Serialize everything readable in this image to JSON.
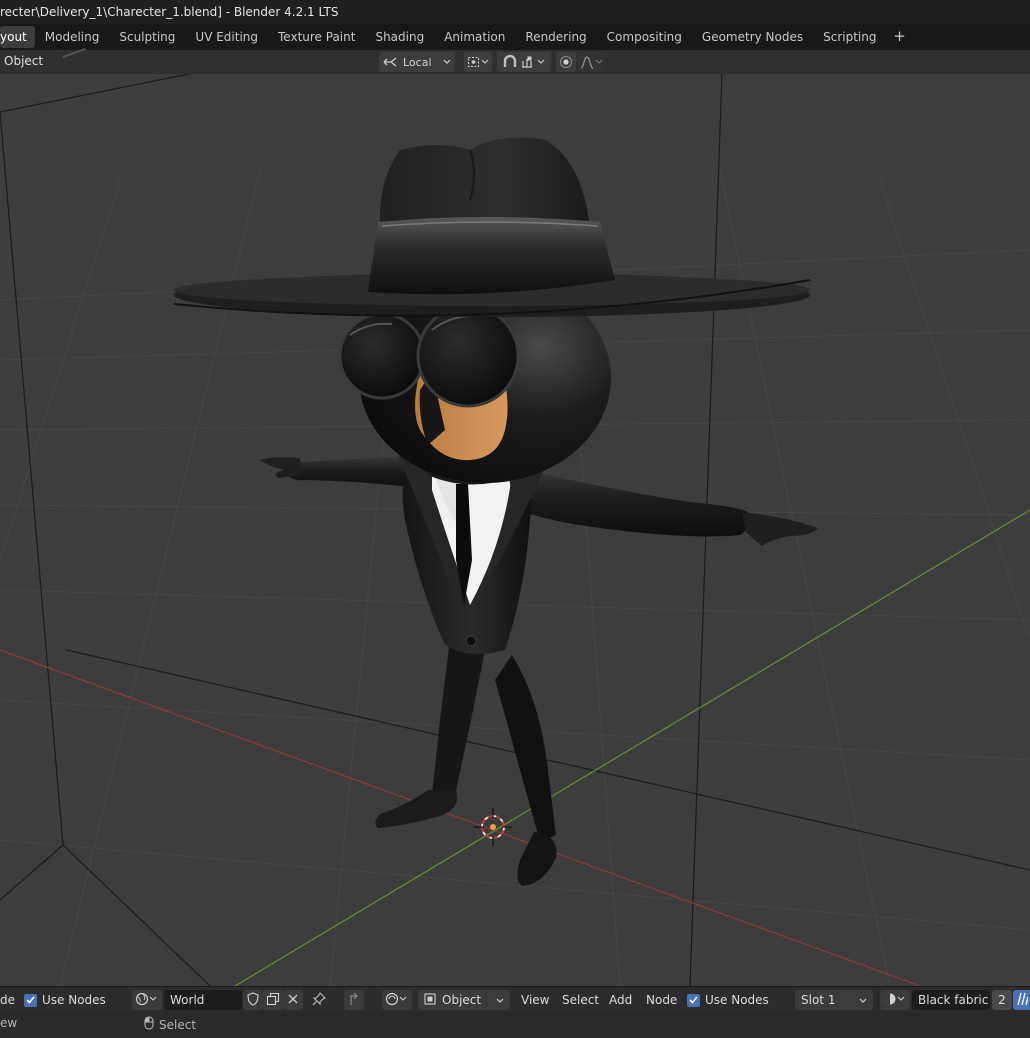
{
  "window": {
    "title": "recter\\Delivery_1\\Charecter_1.blend] - Blender 4.2.1 LTS"
  },
  "workspaces": {
    "active": "yout",
    "tabs": [
      "Modeling",
      "Sculpting",
      "UV Editing",
      "Texture Paint",
      "Shading",
      "Animation",
      "Rendering",
      "Compositing",
      "Geometry Nodes",
      "Scripting"
    ],
    "add_label": "+"
  },
  "viewport_header": {
    "mode_label": "Object",
    "orientation": "Local",
    "icons": [
      "transform-orientation-icon",
      "pivot-icon",
      "snap-magnet-icon",
      "snap-target-icon",
      "proportional-edit-icon",
      "falloff-icon"
    ]
  },
  "viewport": {
    "object": "character",
    "colors": {
      "background": "#3d3d3d",
      "grid": "#474747",
      "x_axis": "#8c3a46",
      "y_axis": "#6a8a2c"
    }
  },
  "node_header": {
    "left_cut_label": "de",
    "use_nodes_left": "Use Nodes",
    "world_field": "World",
    "object_dropdown": "Object",
    "menu": [
      "View",
      "Select",
      "Add",
      "Node"
    ],
    "use_nodes_right": "Use Nodes",
    "slot": "Slot 1",
    "material_name": "Black fabric",
    "user_count": "2"
  },
  "status_bar": {
    "left_cut_label": "ew",
    "select_label": "Select"
  }
}
